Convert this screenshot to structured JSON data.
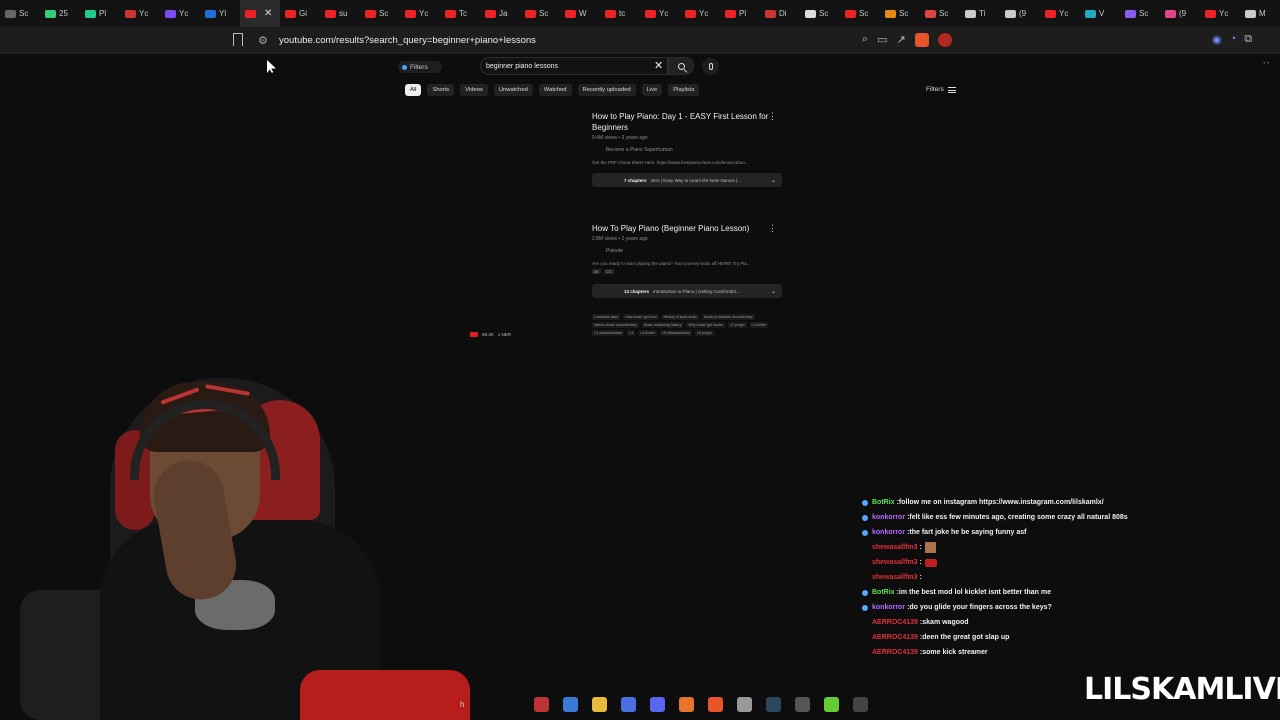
{
  "browser": {
    "tabs": [
      {
        "label": "Sc",
        "color": "#666"
      },
      {
        "label": "25",
        "color": "#3c7"
      },
      {
        "label": "Pl",
        "color": "#2c8"
      },
      {
        "label": "Yc",
        "color": "#c33"
      },
      {
        "label": "Yc",
        "color": "#7a4cf0"
      },
      {
        "label": "Yl",
        "color": "#1f6fd6"
      },
      {
        "label": "",
        "color": "#e22",
        "active": true
      },
      {
        "label": "Gi",
        "color": "#e22"
      },
      {
        "label": "su",
        "color": "#e22"
      },
      {
        "label": "Sc",
        "color": "#e22"
      },
      {
        "label": "Yc",
        "color": "#e22"
      },
      {
        "label": "Tc",
        "color": "#e22"
      },
      {
        "label": "Ja",
        "color": "#e22"
      },
      {
        "label": "Sc",
        "color": "#e22"
      },
      {
        "label": "W",
        "color": "#e22"
      },
      {
        "label": "tc",
        "color": "#e22"
      },
      {
        "label": "Yc",
        "color": "#e22"
      },
      {
        "label": "Yc",
        "color": "#e22"
      },
      {
        "label": "Pl",
        "color": "#e22"
      },
      {
        "label": "Di",
        "color": "#c33"
      },
      {
        "label": "Sc",
        "color": "#ddd"
      },
      {
        "label": "Sc",
        "color": "#e22"
      },
      {
        "label": "Sc",
        "color": "#e98a17"
      },
      {
        "label": "Sc",
        "color": "#d44"
      },
      {
        "label": "Ti",
        "color": "#ccc"
      },
      {
        "label": "(9",
        "color": "#ccc"
      },
      {
        "label": "Yc",
        "color": "#e22"
      },
      {
        "label": "V",
        "color": "#2ab"
      },
      {
        "label": "Sc",
        "color": "#8a5cf0"
      },
      {
        "label": "(9",
        "color": "#e2458c"
      },
      {
        "label": "Yc",
        "color": "#e22"
      },
      {
        "label": "M",
        "color": "#ccc"
      }
    ],
    "close_glyph": "✕",
    "url": "youtube.com/results?search_query=beginner+piano+lessons"
  },
  "search": {
    "filters_chip": "Filters",
    "query": "beginner piano lessons",
    "chips": [
      "All",
      "Shorts",
      "Videos",
      "Unwatched",
      "Watched",
      "Recently uploaded",
      "Live",
      "Playlists"
    ],
    "filters_right": "Filters"
  },
  "results": [
    {
      "title": "How to Play Piano: Day 1 - EASY First Lesson for Beginners",
      "meta": "9.4M views • 3 years ago",
      "channel": "Become a Piano Superhuman",
      "description": "Get the PDF Cheat Sheet Here: https://www.bestpianoclass.com/lesson1bon...",
      "chapters_count": "7 chapters",
      "chapters_text": "Intro | Easy Way to Learn the Note Names |..."
    },
    {
      "title": "How To Play Piano (Beginner Piano Lesson)",
      "meta": "2.8M views • 2 years ago",
      "channel": "Pianote",
      "description": "Are you ready to start playing the piano? Your journey kicks off HERE! Try Pia...",
      "badges": [
        "4K",
        "CC"
      ],
      "chapters_count": "13 chapters",
      "chapters_text": "Introduction to Piano | Getting Comfortabl..."
    }
  ],
  "tags": [
    "Loudness wars",
    "How music got loud",
    "History of loud music",
    "Music production documentary",
    "Waves Audio documentary",
    "Music mastering history",
    "Why music got louder",
    "L1 plugin",
    "L2 limiter",
    "L3 ultramaximizer",
    "L4",
    "L4 limiter",
    "L5 ultramaximizer",
    "L6 plugin"
  ],
  "live_indicator": {
    "viewers": "58.4K",
    "count": "1 NER"
  },
  "chat": [
    {
      "user": "BotRix",
      "user_class": "u-green",
      "message": "follow me on instagram https://www.instagram.com/lilskamlx/"
    },
    {
      "user": "konkorror",
      "user_class": "u-purple",
      "message": "felt like ess few minutes ago, creating some crazy all natural 808s"
    },
    {
      "user": "konkorror",
      "user_class": "u-purple",
      "message": "the fart joke he be saying funny asf"
    },
    {
      "user": "shewasallfm3",
      "user_class": "u-red",
      "message": "",
      "emote": "emote"
    },
    {
      "user": "shewasallfm3",
      "user_class": "u-red",
      "message": "",
      "emote": "emote-red"
    },
    {
      "user": "shewasallfm3",
      "user_class": "u-red",
      "message": ""
    },
    {
      "user": "BotRix",
      "user_class": "u-green",
      "message": "im the best mod lol kicklet isnt better than me"
    },
    {
      "user": "konkorror",
      "user_class": "u-purple",
      "message": "do you glide your fingers across the keys?"
    },
    {
      "user": "AERROC4139",
      "user_class": "u-red",
      "message": "skam wagood"
    },
    {
      "user": "AERROC4139",
      "user_class": "u-red",
      "message": "deen the great got slap up"
    },
    {
      "user": "AERROC4139",
      "user_class": "u-red",
      "message": "some kick streamer"
    }
  ],
  "watermark": "LILSKAMLIVE",
  "taskbar": {
    "search_text": "h",
    "icons": [
      {
        "name": "flag-icon",
        "color": "#b33"
      },
      {
        "name": "copilot-icon",
        "color": "#3a7bd5"
      },
      {
        "name": "file-explorer-icon",
        "color": "#e8b93a"
      },
      {
        "name": "store-icon",
        "color": "#4a6fe0"
      },
      {
        "name": "discord-icon",
        "color": "#5865f2"
      },
      {
        "name": "firefox-icon",
        "color": "#e8762a"
      },
      {
        "name": "brave-icon",
        "color": "#e8552a"
      },
      {
        "name": "chrome-icon",
        "color": "#999"
      },
      {
        "name": "steam-icon",
        "color": "#2b475e"
      },
      {
        "name": "app-icon",
        "color": "#555"
      },
      {
        "name": "bluestacks-icon",
        "color": "#6c3"
      },
      {
        "name": "4k-icon",
        "color": "#444"
      }
    ]
  }
}
